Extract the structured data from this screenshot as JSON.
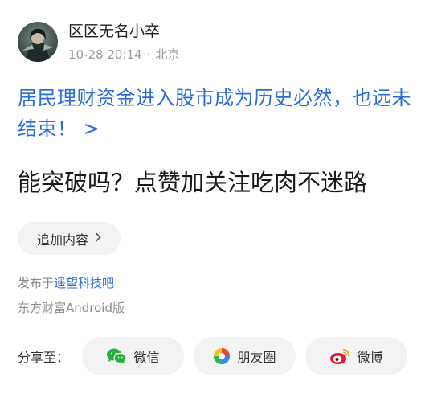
{
  "post": {
    "username": "区区无名小卒",
    "date": "10-28 20:14",
    "separator": "·",
    "location": "北京",
    "article_link": "居民理财资金进入股市成为历史必然，也远未结束！ >",
    "body": "能突破吗？点赞加关注吃肉不迷路",
    "append_label": "追加内容",
    "published_prefix": "发布于",
    "forum_name": "遥望科技吧",
    "client": "东方财富Android版"
  },
  "share": {
    "label": "分享至：",
    "buttons": [
      {
        "label": "微信",
        "icon": "wechat-icon",
        "color": "#2bad3a"
      },
      {
        "label": "朋友圈",
        "icon": "moments-icon",
        "color": "#f5a623"
      },
      {
        "label": "微博",
        "icon": "weibo-icon",
        "color": "#e6162d"
      }
    ]
  },
  "colors": {
    "link": "#2b6dd3",
    "muted": "#9a9a9a",
    "button_bg": "#f3f3f3"
  }
}
